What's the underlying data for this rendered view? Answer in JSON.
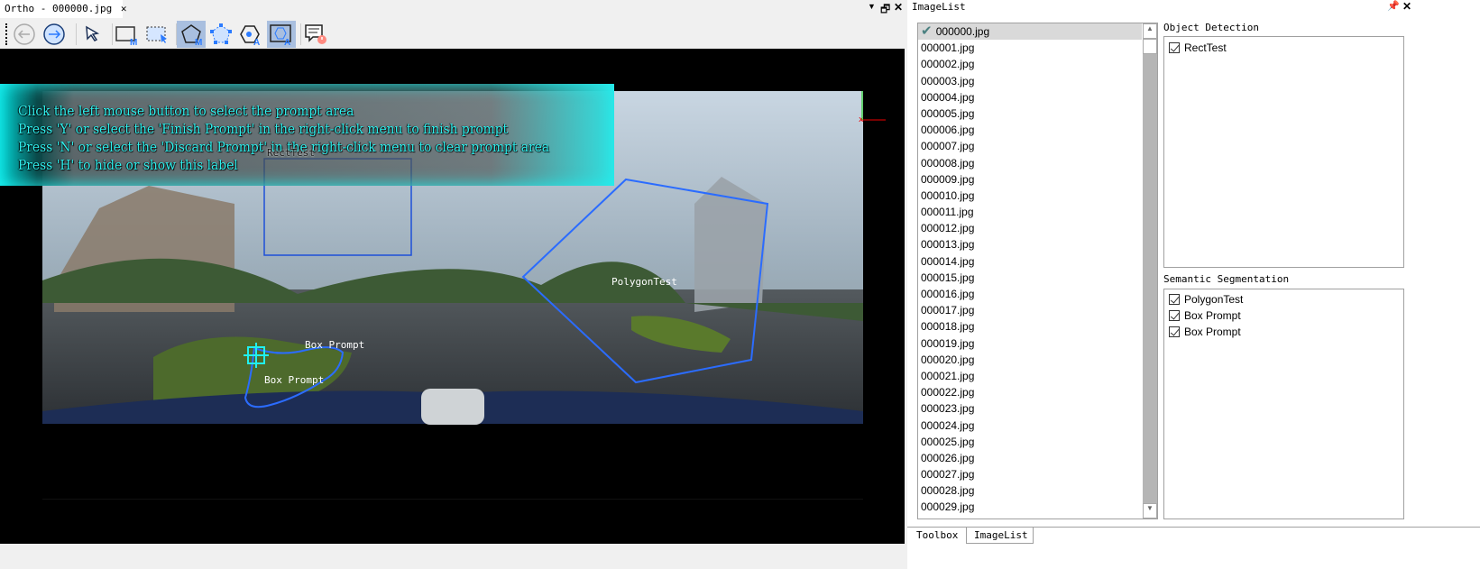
{
  "document_tab": {
    "title": "Ortho - 000000.jpg",
    "close_icon": "close-icon"
  },
  "window_controls": {
    "menu": "dropdown-arrow-icon",
    "restore": "restore-icon",
    "close": "close-icon"
  },
  "toolbar": {
    "tools": [
      "back-icon",
      "forward-icon",
      "select-pointer-icon",
      "rect-manual-icon",
      "rect-select-icon",
      "polygon-manual-icon",
      "polygon-points-icon",
      "polygon-auto-point-icon",
      "box-prompt-auto-icon",
      "prompt-settings-icon"
    ],
    "active": [
      "polygon-manual-icon",
      "box-prompt-auto-icon"
    ]
  },
  "canvas": {
    "instructions": [
      "Click the left mouse button to select the prompt area",
      "Press 'Y' or select the 'Finish Prompt' in the right-click menu to finish prompt",
      "Press 'N' or select the 'Discard Prompt' in the right-click menu to clear prompt area",
      "Press 'H' to hide or show this label"
    ],
    "annotations": {
      "rect": "RectTest",
      "polygon": "PolygonTest",
      "box1": "Box Prompt",
      "box2": "Box Prompt"
    },
    "axis_x": "x",
    "annotation_color": "#2b6cff",
    "overlay_color": "#2ff0ee"
  },
  "panel": {
    "title": "ImageList",
    "images": [
      "000000.jpg",
      "000001.jpg",
      "000002.jpg",
      "000003.jpg",
      "000004.jpg",
      "000005.jpg",
      "000006.jpg",
      "000007.jpg",
      "000008.jpg",
      "000009.jpg",
      "000010.jpg",
      "000011.jpg",
      "000012.jpg",
      "000013.jpg",
      "000014.jpg",
      "000015.jpg",
      "000016.jpg",
      "000017.jpg",
      "000018.jpg",
      "000019.jpg",
      "000020.jpg",
      "000021.jpg",
      "000022.jpg",
      "000023.jpg",
      "000024.jpg",
      "000025.jpg",
      "000026.jpg",
      "000027.jpg",
      "000028.jpg",
      "000029.jpg"
    ],
    "selected": "000000.jpg",
    "object_detection": {
      "label": "Object Detection",
      "items": [
        "RectTest"
      ]
    },
    "semantic_segmentation": {
      "label": "Semantic Segmentation",
      "items": [
        "PolygonTest",
        "Box Prompt",
        "Box Prompt"
      ]
    },
    "bottom_tabs": [
      "Toolbox",
      "ImageList"
    ]
  }
}
